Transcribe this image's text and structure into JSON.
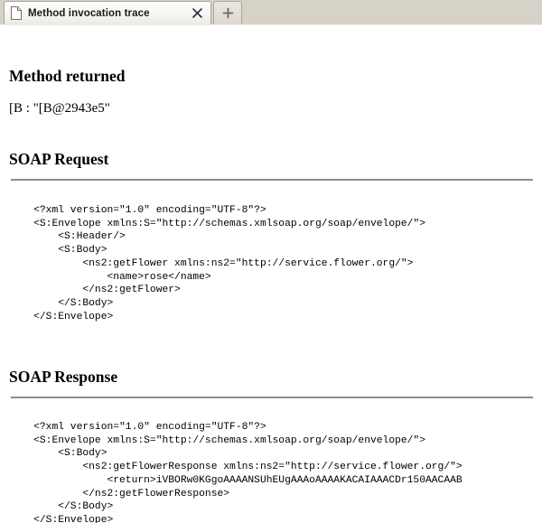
{
  "window": {
    "tabs": [
      {
        "label": "Method invocation trace",
        "icon": "document-icon",
        "close_icon": "close-icon",
        "active": true
      },
      {
        "label": "",
        "icon": "plus-icon",
        "active": false
      }
    ]
  },
  "colors": {
    "tabbar_background": "#d6d2c8",
    "tab_border": "#a8a49a",
    "rule": "#8d8d8d",
    "page_background": "#ffffff",
    "text": "#000000"
  },
  "content": {
    "method_returned": {
      "title": "Method returned",
      "value": "[B : \"[B@2943e5\""
    },
    "soap_request": {
      "title": "SOAP Request",
      "xml": "    <?xml version=\"1.0\" encoding=\"UTF-8\"?>\n    <S:Envelope xmlns:S=\"http://schemas.xmlsoap.org/soap/envelope/\">\n        <S:Header/>\n        <S:Body>\n            <ns2:getFlower xmlns:ns2=\"http://service.flower.org/\">\n                <name>rose</name>\n            </ns2:getFlower>\n        </S:Body>\n    </S:Envelope>"
    },
    "soap_response": {
      "title": "SOAP Response",
      "xml": "    <?xml version=\"1.0\" encoding=\"UTF-8\"?>\n    <S:Envelope xmlns:S=\"http://schemas.xmlsoap.org/soap/envelope/\">\n        <S:Body>\n            <ns2:getFlowerResponse xmlns:ns2=\"http://service.flower.org/\">\n                <return>iVBORw0KGgoAAAANSUhEUgAAAoAAAAKACAIAAACDr150AACAAB\n            </ns2:getFlowerResponse>\n        </S:Body>\n    </S:Envelope>"
    }
  }
}
